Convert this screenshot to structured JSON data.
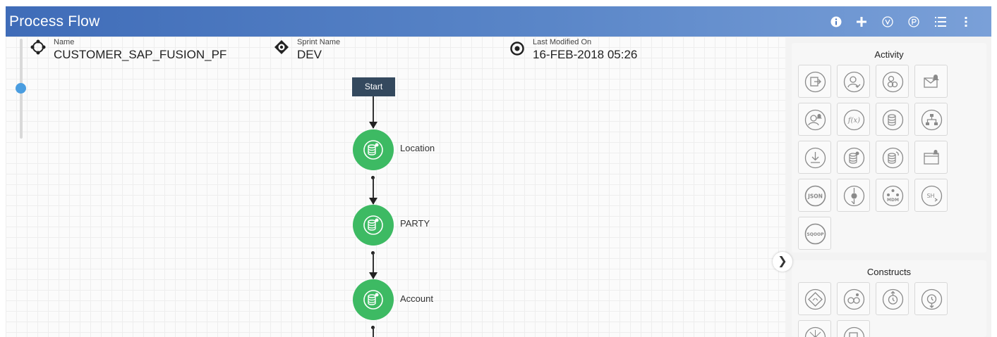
{
  "header": {
    "title": "Process Flow",
    "icons": [
      "info-icon",
      "plus-icon",
      "v-circle-icon",
      "p-circle-icon",
      "list-icon",
      "more-vertical-icon"
    ]
  },
  "meta": {
    "name_label": "Name",
    "name_value": "CUSTOMER_SAP_FUSION_PF",
    "sprint_label": "Sprint Name",
    "sprint_value": "DEV",
    "modified_label": "Last Modified On",
    "modified_value": "16-FEB-2018 05:26"
  },
  "flow": {
    "start_label": "Start",
    "nodes": [
      {
        "label": "Location",
        "icon": "database-icon"
      },
      {
        "label": "PARTY",
        "icon": "database-icon"
      },
      {
        "label": "Account",
        "icon": "database-icon"
      }
    ]
  },
  "palette": {
    "activity_title": "Activity",
    "activity_icons": [
      "file-import-icon",
      "user-check-icon",
      "users-check-icon",
      "email-alert-icon",
      "user-alert-icon",
      "function-icon",
      "database-copy-icon",
      "hierarchy-icon",
      "download-icon",
      "database-alert-icon",
      "database-refresh-icon",
      "window-alert-icon",
      "json-icon",
      "script-icon",
      "mdm-icon",
      "shell-icon",
      "sqoop-icon"
    ],
    "json_text": "JSON",
    "mdm_text": "MDM",
    "shell_text": "SH",
    "sqoop_text": "SQOOP",
    "constructs_title": "Constructs",
    "construct_icons": [
      "decision-icon",
      "loop-icon",
      "timer-icon",
      "wait-icon",
      "fork-icon",
      "end-icon"
    ]
  },
  "colors": {
    "header": "#4a78c0",
    "node": "#3dba63",
    "start": "#34495e",
    "zoom": "#4a9de0"
  }
}
